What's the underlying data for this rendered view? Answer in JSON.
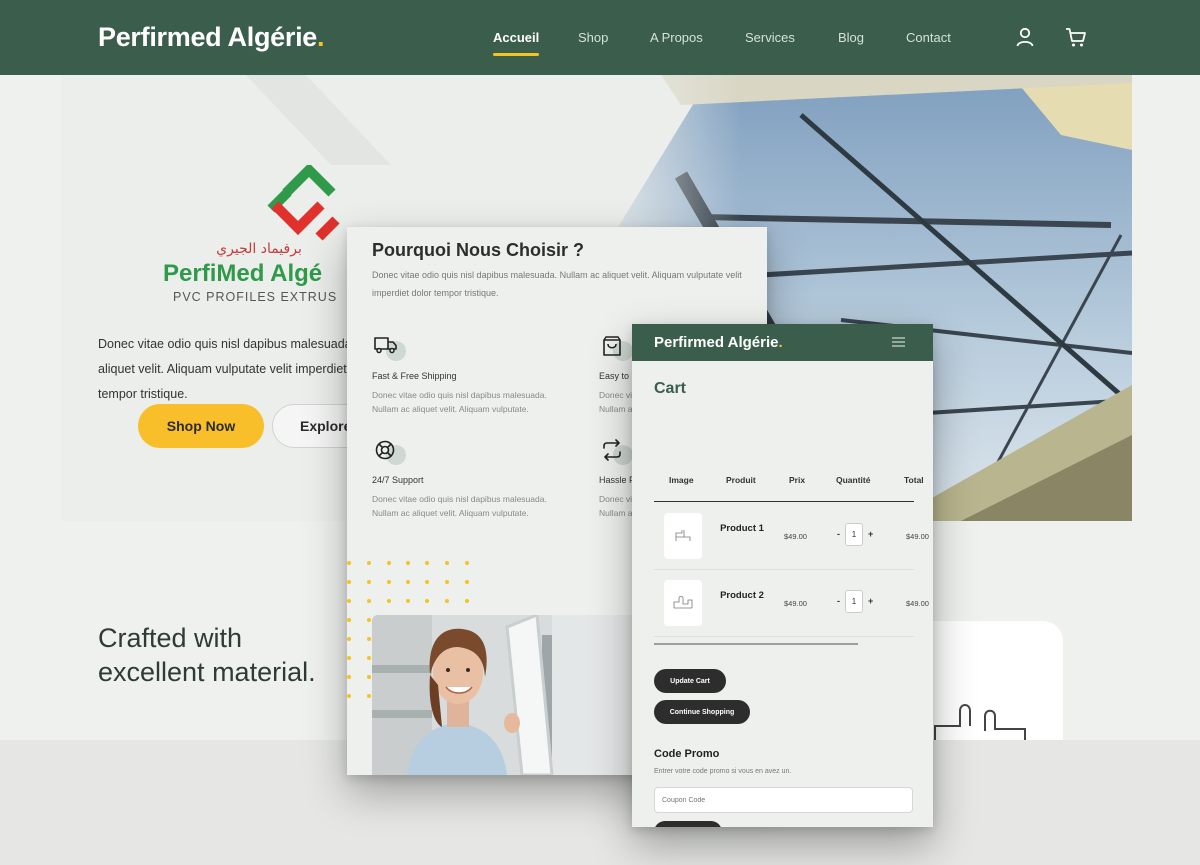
{
  "site": {
    "brand": "Perfirmed Algérie",
    "brand_dot": ".",
    "nav": [
      "Accueil",
      "Shop",
      "A Propos",
      "Services",
      "Blog",
      "Contact"
    ],
    "active_nav": "Accueil",
    "icons": [
      "user-icon",
      "cart-icon"
    ]
  },
  "hero": {
    "logo_arabic": "برفيماد الجيري",
    "logo_name": "PerfiMed Algé",
    "logo_tagline": "PVC PROFILES EXTRUS",
    "text": "Donec vitae odio quis nisl dapibus malesuada. Nullam ac aliquet velit. Aliquam vulputate velit imperdiet dolor tempor tristique.",
    "shop_button": "Shop Now",
    "explore_button": "Explore"
  },
  "crafted": {
    "heading": "Crafted with excellent material."
  },
  "why": {
    "title": "Pourquoi Nous Choisir ?",
    "subtitle": "Donec vitae odio quis nisl dapibus malesuada. Nullam ac aliquet velit. Aliquam vulputate velit imperdiet dolor tempor tristique.",
    "features": [
      {
        "title": "Fast & Free Shipping",
        "text": "Donec vitae odio quis nisl dapibus malesuada. Nullam ac aliquet velit. Aliquam vulputate.",
        "icon": "truck-icon"
      },
      {
        "title": "Easy to Shop",
        "text": "Donec vitae odio quis nisl dapibus malesuada. Nullam ac aliquet velit. Aliquam vulputate.",
        "icon": "bag-icon"
      },
      {
        "title": "24/7 Support",
        "text": "Donec vitae odio quis nisl dapibus malesuada. Nullam ac aliquet velit. Aliquam vulputate.",
        "icon": "support-icon"
      },
      {
        "title": "Hassle Free Returns",
        "text": "Donec vitae odio quis nisl dapibus malesuada. Nullam ac aliquet velit. Aliquam vulputate.",
        "icon": "return-icon"
      }
    ]
  },
  "cart": {
    "brand": "Perfirmed Algérie",
    "brand_dot": ".",
    "title": "Cart",
    "columns": [
      "Image",
      "Produit",
      "Prix",
      "Quantité",
      "Total"
    ],
    "items": [
      {
        "name": "Product 1",
        "price": "$49.00",
        "qty": "1",
        "total": "$49.00"
      },
      {
        "name": "Product 2",
        "price": "$49.00",
        "qty": "1",
        "total": "$49.00"
      }
    ],
    "update_button": "Update Cart",
    "continue_button": "Continue Shopping",
    "promo_title": "Code Promo",
    "promo_sub": "Entrer votre code promo si vous en avez un.",
    "promo_placeholder": "Coupon Code",
    "qty_minus": "-",
    "qty_plus": "+"
  },
  "colors": {
    "brand_green": "#3b5d4c",
    "accent_yellow": "#f8bf2b",
    "dark_button": "#2d2d2d"
  }
}
